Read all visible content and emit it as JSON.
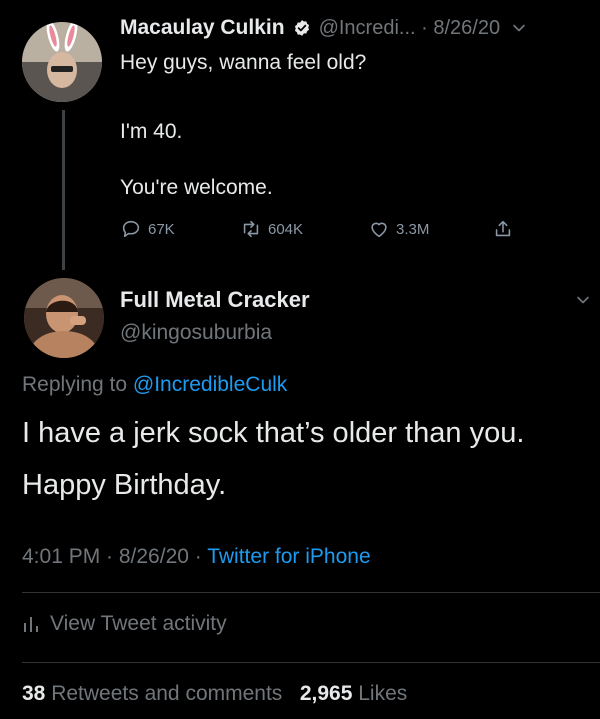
{
  "parent_tweet": {
    "author_name": "Macaulay Culkin",
    "handle_and_date": "@Incredi... · 8/26/20",
    "text_line1": "Hey guys, wanna feel old?",
    "text_line2": "I'm 40.",
    "text_line3": "You're welcome.",
    "replies": "67K",
    "retweets": "604K",
    "likes": "3.3M"
  },
  "reply_tweet": {
    "author_name": "Full Metal Cracker",
    "handle": "@kingosuburbia",
    "replying_prefix": "Replying to ",
    "replying_to": "@IncredibleCulk",
    "text_line1": "I have a jerk sock that’s older than you.",
    "text_line2": "Happy Birthday.",
    "timestamp": "4:01 PM · 8/26/20 · ",
    "source": "Twitter for iPhone",
    "activity_label": "View Tweet activity",
    "retweets_count": "38",
    "retweets_label": "Retweets and comments",
    "likes_count": "2,965",
    "likes_label": "Likes"
  },
  "colors": {
    "background": "#000000",
    "text": "#e7e9ea",
    "muted": "#71767b",
    "link": "#1d9bf0",
    "divider": "#2f3336"
  }
}
